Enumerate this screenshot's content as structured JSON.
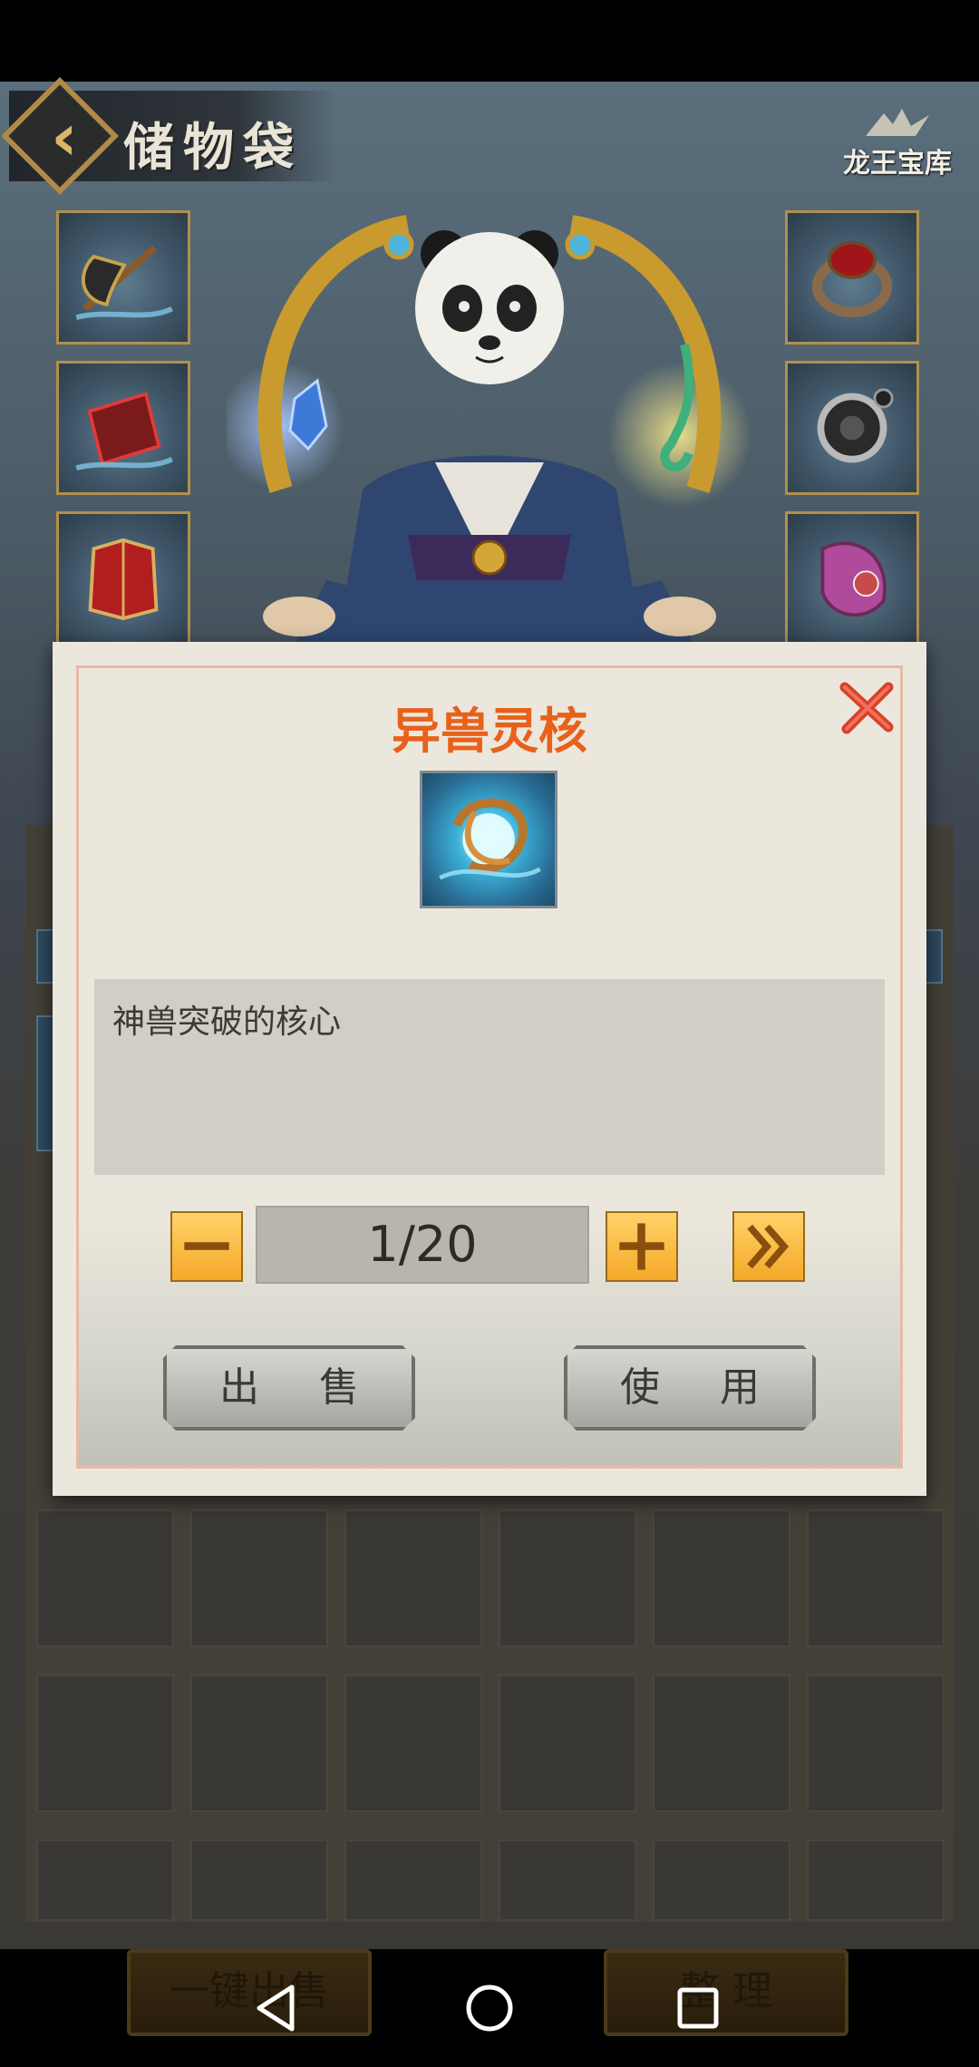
{
  "header": {
    "title": "储物袋",
    "logo_text": "龙王宝库"
  },
  "dialog": {
    "title": "异兽灵核",
    "description": "神兽突破的核心",
    "quantity": "1/20",
    "sell_label": "出 售",
    "use_label": "使 用"
  },
  "bottom": {
    "sell_all_label": "一键出售",
    "sort_label": "整 理"
  },
  "colors": {
    "title_orange": "#e8611a",
    "close_red": "#d9402a",
    "gold": "#f4a827"
  }
}
